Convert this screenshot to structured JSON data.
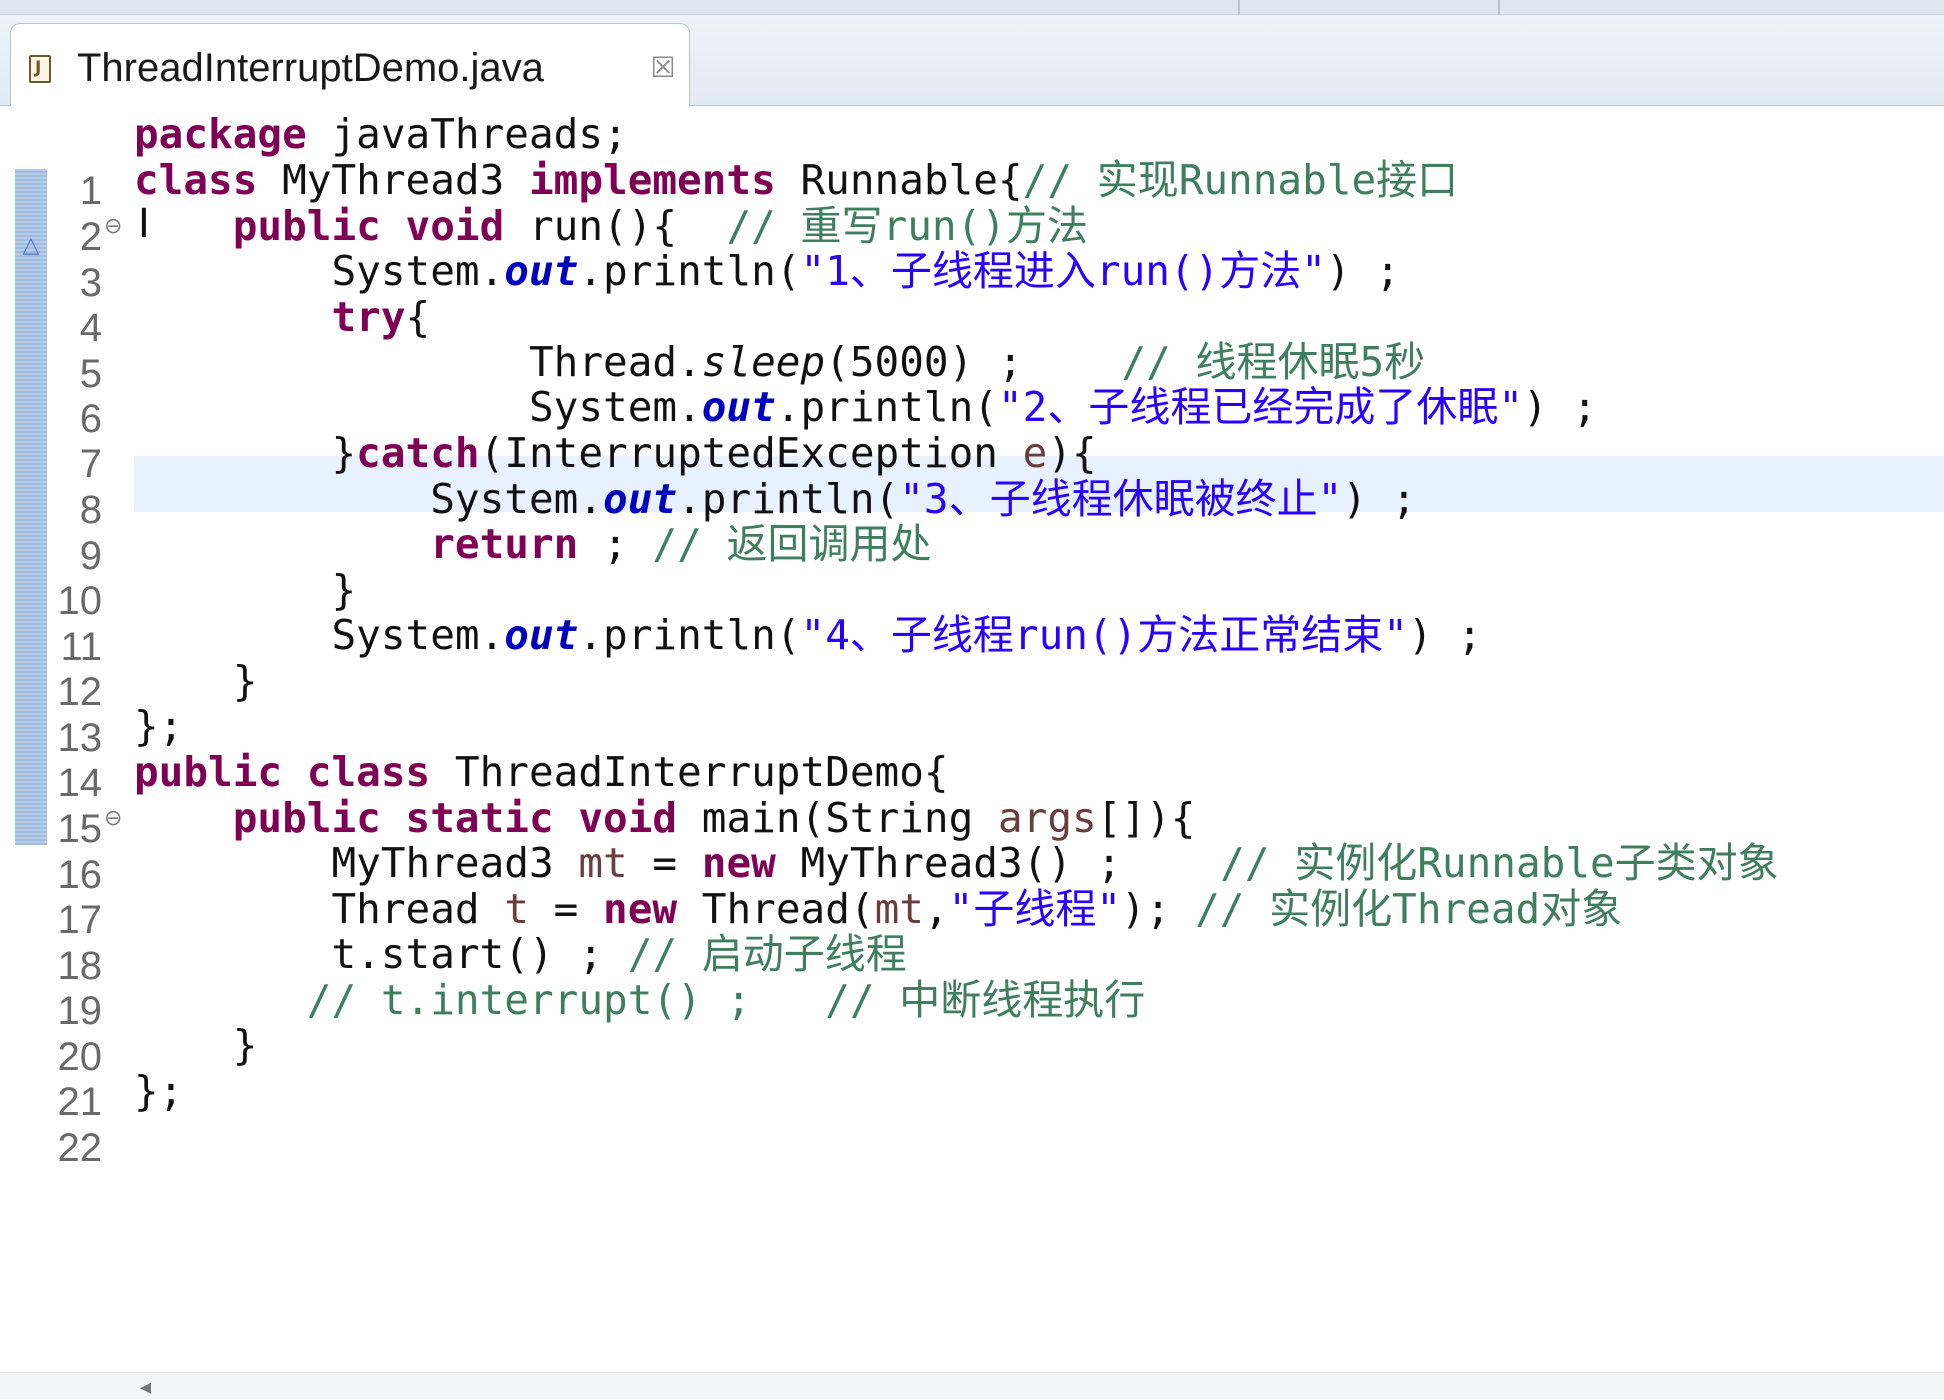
{
  "editor_tab": {
    "title": "ThreadInterruptDemo.java",
    "close_glyph": "☒"
  },
  "text_cursor_glyph": "I",
  "fold_marker_glyph": "△",
  "line_numbers": [
    "1",
    "2",
    "3",
    "4",
    "5",
    "6",
    "7",
    "8",
    "9",
    "10",
    "11",
    "12",
    "13",
    "14",
    "15",
    "16",
    "17",
    "18",
    "19",
    "20",
    "21",
    "22"
  ],
  "code": {
    "l1": {
      "kw1": "package",
      "t1": " javaThreads;"
    },
    "l2": {
      "kw1": "class",
      "t1": " MyThread3 ",
      "kw2": "implements",
      "t2": " Runnable{",
      "cm": "// 实现Runnable接口"
    },
    "l3": {
      "indent": "    ",
      "kw1": "public",
      "t1": " ",
      "kw2": "void",
      "t2": " run(){  ",
      "cm": "// 重写run()方法"
    },
    "l4": {
      "indent": "        ",
      "t1": "System.",
      "f1": "out",
      "t2": ".println(",
      "s1": "\"1、子线程进入run()方法\"",
      "t3": ") ;"
    },
    "l5": {
      "indent": "        ",
      "kw1": "try",
      "t1": "{"
    },
    "l6": {
      "indent": "                ",
      "t1": "Thread.",
      "m1": "sleep",
      "t2": "(5000) ;    ",
      "cm": "// 线程休眠5秒"
    },
    "l7": {
      "indent": "                ",
      "t1": "System.",
      "f1": "out",
      "t2": ".println(",
      "s1": "\"2、子线程已经完成了休眠\"",
      "t3": ") ;"
    },
    "l8": {
      "indent": "        ",
      "t1": "}",
      "kw1": "catch",
      "t2": "(InterruptedException ",
      "p1": "e",
      "t3": "){"
    },
    "l9": {
      "indent": "            ",
      "t1": "System.",
      "f1": "out",
      "t2": ".println(",
      "s1": "\"3、子线程休眠被终止\"",
      "t3": ") ;"
    },
    "l10": {
      "indent": "            ",
      "kw1": "return",
      "t1": " ; ",
      "cm": "// 返回调用处"
    },
    "l11": {
      "indent": "        ",
      "t1": "}"
    },
    "l12": {
      "indent": "        ",
      "t1": "System.",
      "f1": "out",
      "t2": ".println(",
      "s1": "\"4、子线程run()方法正常结束\"",
      "t3": ") ;"
    },
    "l13": {
      "indent": "    ",
      "t1": "}"
    },
    "l14": {
      "t1": "};"
    },
    "l15": {
      "kw1": "public",
      "t1": " ",
      "kw2": "class",
      "t2": " ThreadInterruptDemo{"
    },
    "l16": {
      "indent": "    ",
      "kw1": "public",
      "t1": " ",
      "kw2": "static",
      "t2": " ",
      "kw3": "void",
      "t3": " main(String ",
      "p1": "args",
      "t4": "[]){"
    },
    "l17": {
      "indent": "        ",
      "t1": "MyThread3 ",
      "p1": "mt",
      "t2": " = ",
      "kw1": "new",
      "t3": " MyThread3() ;    ",
      "cm": "// 实例化Runnable子类对象"
    },
    "l18": {
      "indent": "        ",
      "t1": "Thread ",
      "p1": "t",
      "t2": " = ",
      "kw1": "new",
      "t3": " Thread(",
      "p2": "mt",
      "t4": ",",
      "s1": "\"子线程\"",
      "t5": "); ",
      "cm": "// 实例化Thread对象"
    },
    "l19": {
      "indent": "        ",
      "t1": "t.start() ; ",
      "cm": "// 启动子线程"
    },
    "l20": {
      "indent": "       ",
      "cm": "// t.interrupt() ;   // 中断线程执行"
    },
    "l21": {
      "indent": "    ",
      "t1": "}"
    },
    "l22": {
      "t1": "};"
    }
  },
  "colors": {
    "keyword": "#7f0055",
    "comment": "#3f7f5f",
    "string": "#2a00ff",
    "field": "#0000c0",
    "current_line": "#e8f2fe"
  }
}
